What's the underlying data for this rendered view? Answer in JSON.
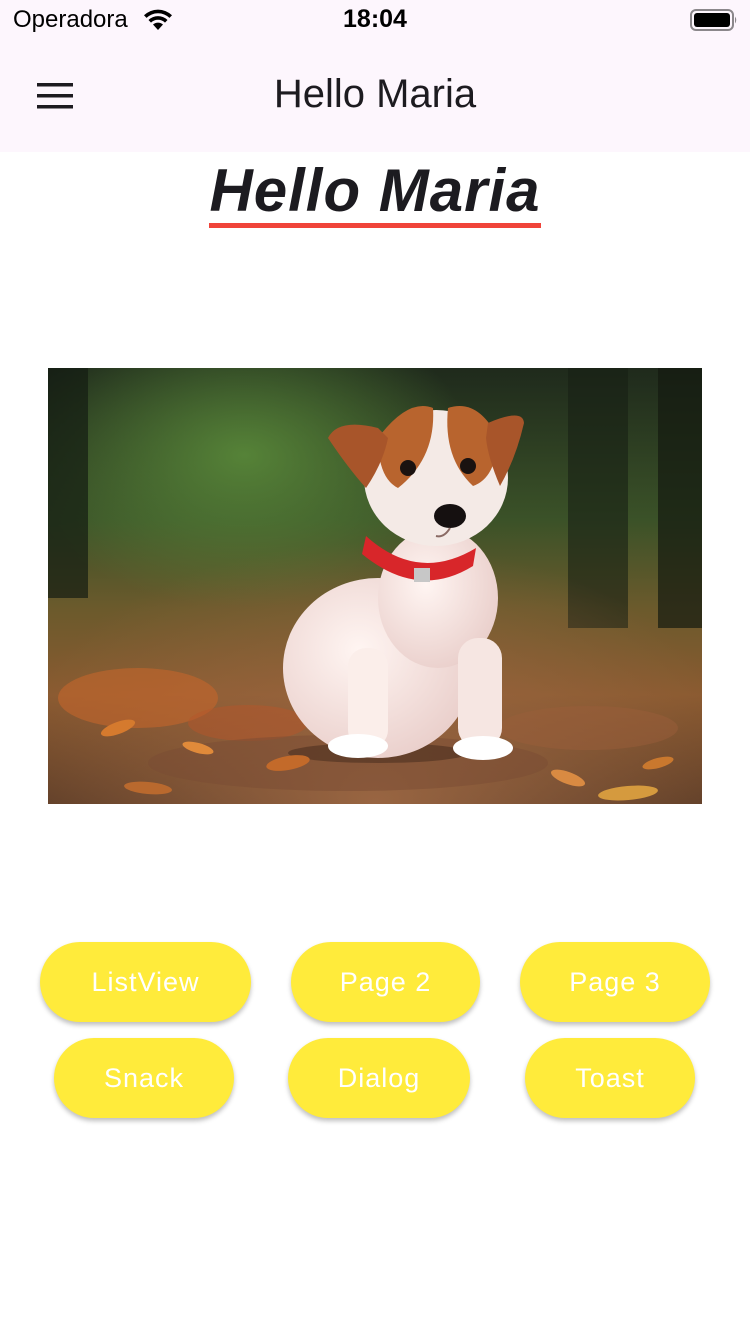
{
  "status_bar": {
    "carrier": "Operadora",
    "time": "18:04",
    "wifi_icon": "wifi-icon",
    "battery_icon": "battery-full-icon"
  },
  "app_bar": {
    "menu_icon": "hamburger-menu-icon",
    "title": "Hello Maria",
    "background": "#fdf6fd"
  },
  "main": {
    "heading": "Hello Maria",
    "heading_underline_color": "#f0443a",
    "image": "puppy-photo"
  },
  "buttons": {
    "row1": [
      "ListView",
      "Page 2",
      "Page 3"
    ],
    "row2": [
      "Snack",
      "Dialog",
      "Toast"
    ],
    "color": "#ffeb3b",
    "text_color": "#ffffff"
  }
}
